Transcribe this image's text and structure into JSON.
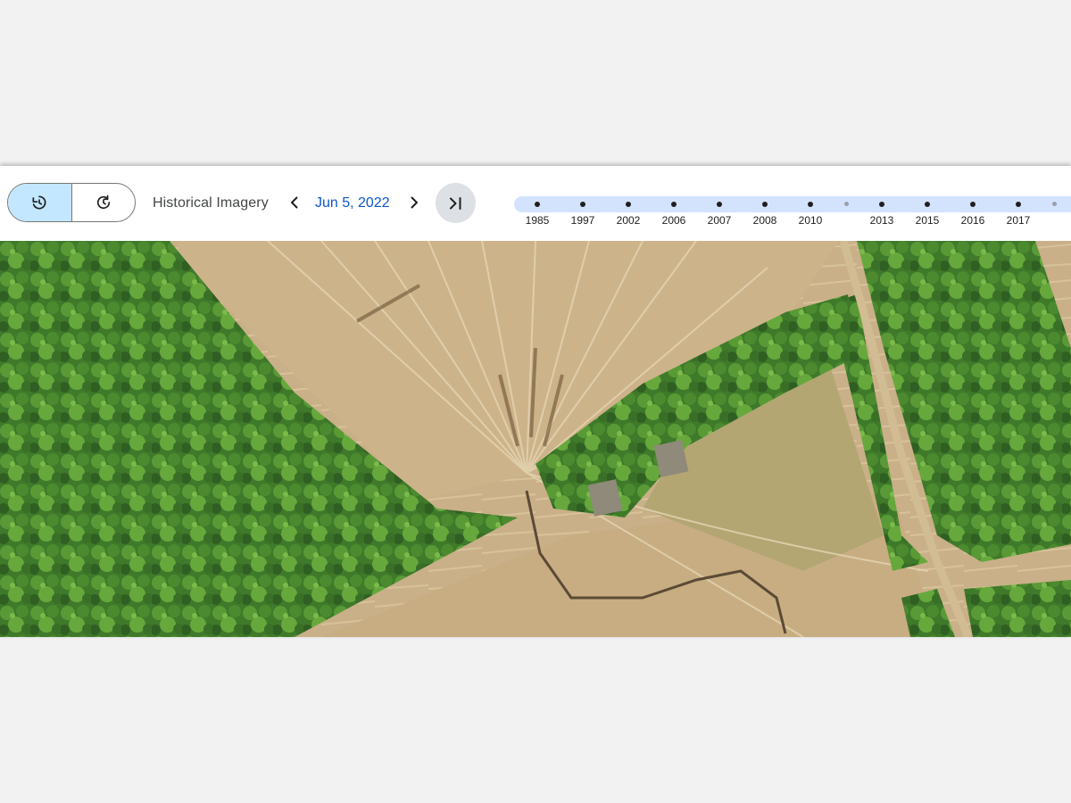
{
  "toolbar": {
    "historical_label": "Historical Imagery",
    "current_date": "Jun 5, 2022",
    "segmented": [
      {
        "name": "history-icon",
        "active": true
      },
      {
        "name": "refresh-icon",
        "active": false
      }
    ],
    "prev_icon": "chevron-left-icon",
    "next_icon": "chevron-right-icon",
    "latest_icon": "skip-to-latest-icon"
  },
  "timeline": {
    "years": [
      "1985",
      "1997",
      "2002",
      "2006",
      "2007",
      "2008",
      "2010",
      "",
      "2013",
      "2015",
      "2016",
      "2017",
      ""
    ],
    "colors": {
      "track": "#d3e3fd",
      "active_segment": "#c2e7ff",
      "date": "#0b57d0"
    }
  },
  "map": {
    "type": "satellite-imagery"
  }
}
